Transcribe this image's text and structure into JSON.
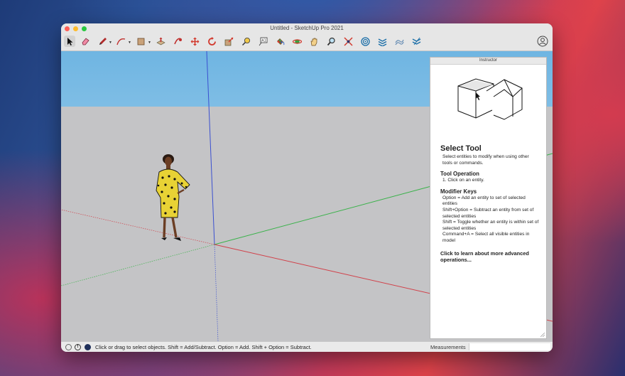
{
  "window": {
    "title": "Untitled - SketchUp Pro 2021"
  },
  "toolbar": {
    "tools": [
      {
        "name": "select"
      },
      {
        "name": "eraser"
      },
      {
        "name": "pencil"
      },
      {
        "name": "arc"
      },
      {
        "name": "rectangle"
      },
      {
        "name": "push-pull"
      },
      {
        "name": "move"
      },
      {
        "name": "rotate"
      },
      {
        "name": "scale"
      },
      {
        "name": "offset"
      },
      {
        "name": "tape-measure"
      },
      {
        "name": "text"
      },
      {
        "name": "paint-bucket"
      },
      {
        "name": "orbit"
      },
      {
        "name": "pan"
      },
      {
        "name": "zoom"
      },
      {
        "name": "zoom-extents"
      },
      {
        "name": "warehouse"
      },
      {
        "name": "extension"
      },
      {
        "name": "sandbox"
      },
      {
        "name": "layout"
      }
    ]
  },
  "instructor": {
    "header": "Instructor",
    "title": "Select Tool",
    "description": "Select entities to modify when using other tools or commands.",
    "operation_heading": "Tool Operation",
    "operation_steps": [
      "1. Click on an entity."
    ],
    "modifier_heading": "Modifier Keys",
    "modifier_lines": [
      "Option = Add an entity to set of selected entities",
      "Shift+Option = Subtract an entity from set of selected entities",
      "Shift = Toggle whether an entity is within set of selected entities",
      "Command+A = Select all visible entities in model"
    ],
    "learn_more": "Click to learn about more advanced operations..."
  },
  "status": {
    "message": "Click or drag to select objects. Shift = Add/Subtract. Option = Add. Shift + Option = Subtract.",
    "measurements_label": "Measurements",
    "measurements_value": ""
  },
  "colors": {
    "sky_top": "#6fb5e2",
    "ground": "#c4c4c6",
    "axis_red": "#d1414a",
    "axis_green": "#3ab24a",
    "axis_blue": "#3a4fd0"
  }
}
